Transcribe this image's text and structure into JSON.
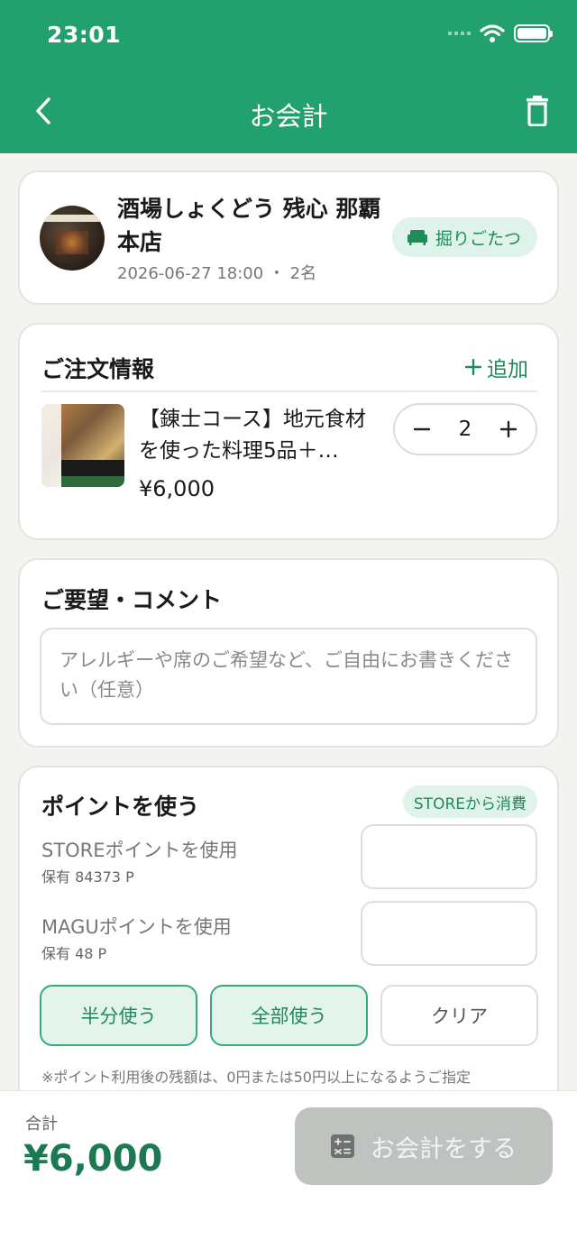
{
  "status_bar": {
    "time": "23:01"
  },
  "nav": {
    "title": "お会計"
  },
  "store": {
    "name": "酒場しょくどう 残心 那覇本店",
    "meta": "2026-06-27  18:00 ・ 2名",
    "seat_badge": "掘りごたつ"
  },
  "order": {
    "title": "ご注文情報",
    "add_label": "追加",
    "items": [
      {
        "name": "【錬士コース】地元食材を使った料理5品＋…",
        "price": "¥6,000",
        "quantity": "2"
      }
    ]
  },
  "comment": {
    "title": "ご要望・コメント",
    "placeholder": "アレルギーや席のご希望など、ご自由にお書きください（任意）"
  },
  "points": {
    "title": "ポイントを使う",
    "badge": "STOREから消費",
    "store_label": "STOREポイントを使用",
    "store_held": "保有 84373 P",
    "magu_label": "MAGUポイントを使用",
    "magu_held": "保有 48 P",
    "half_button": "半分使う",
    "all_button": "全部使う",
    "clear_button": "クリア",
    "note": "※ポイント利用後の残額は、0円または50円以上になるようご指定"
  },
  "footer": {
    "total_label": "合計",
    "total_value": "¥6,000",
    "checkout_label": "お会計をする"
  },
  "colors": {
    "primary": "#22a06e",
    "accent_text": "#1f8a5c",
    "disabled": "#bfc3bf"
  }
}
